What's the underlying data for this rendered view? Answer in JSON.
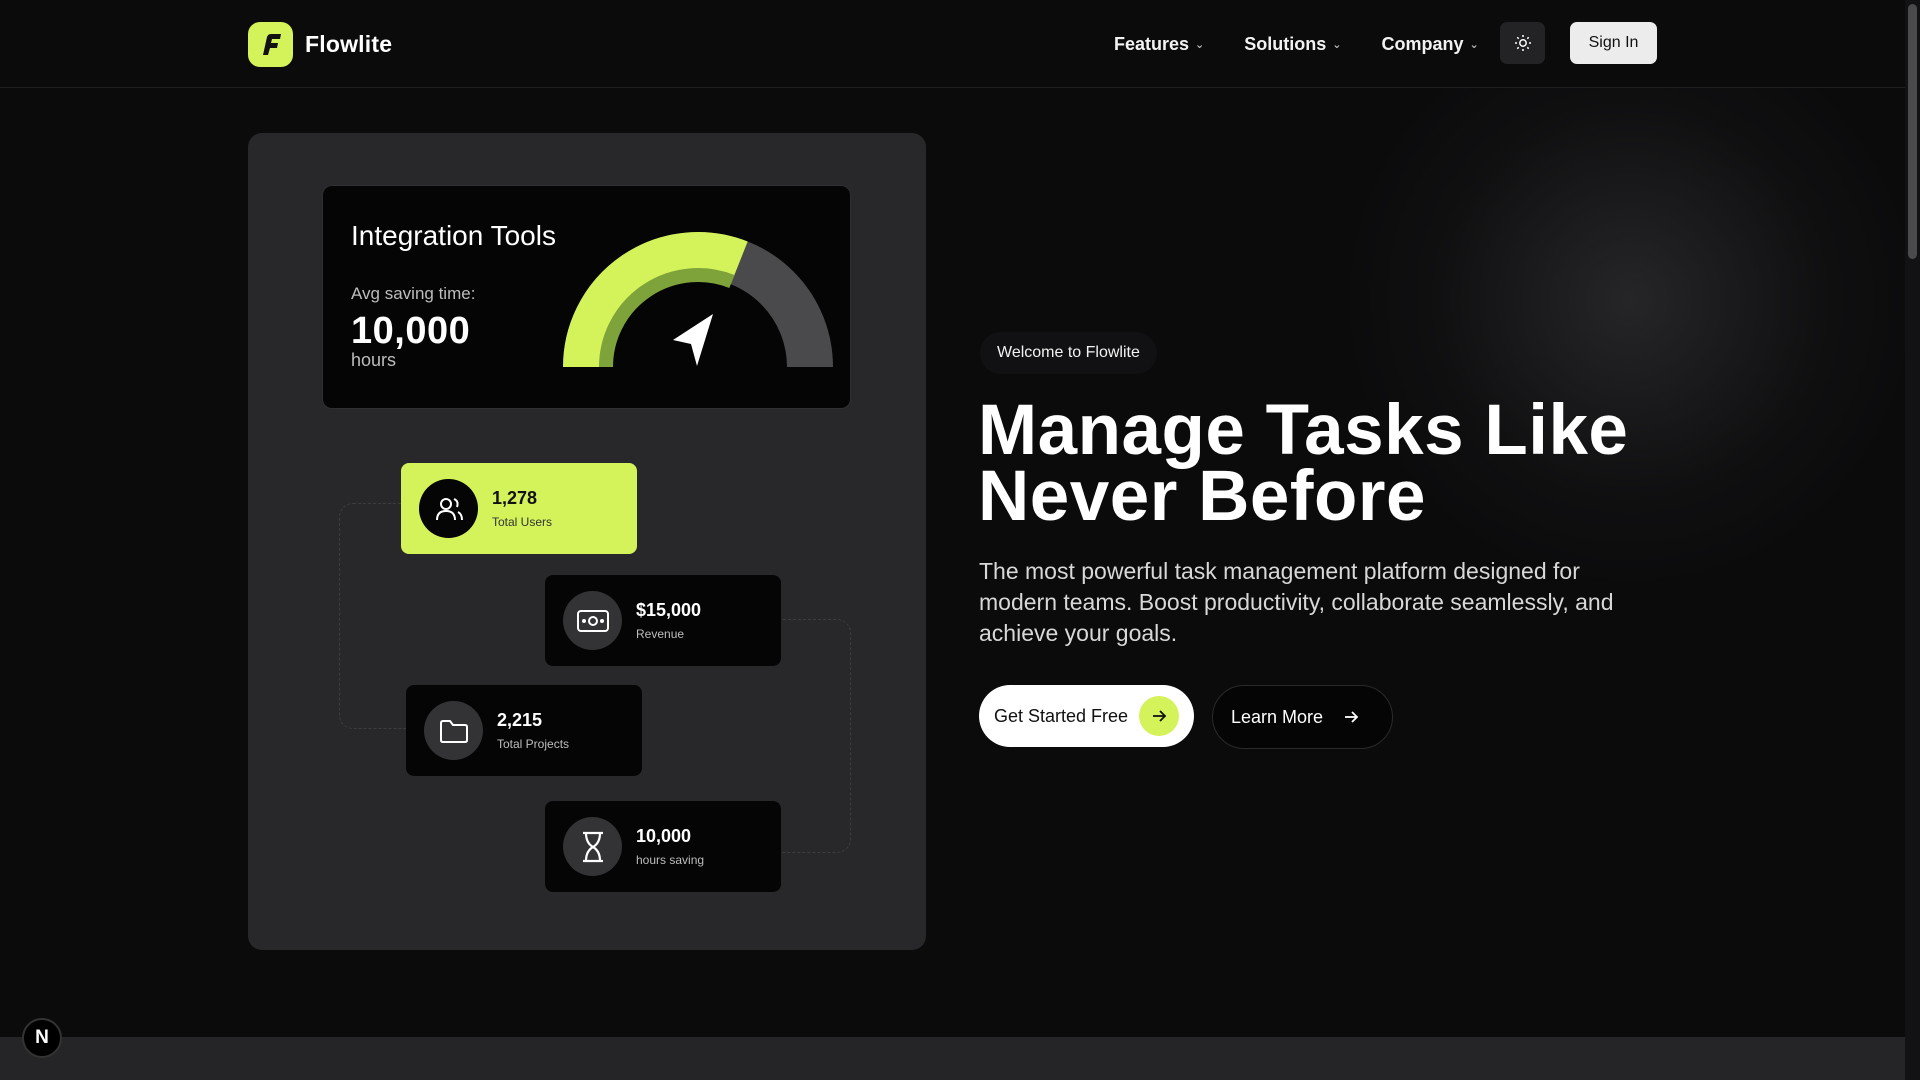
{
  "brand": {
    "name": "Flowlite"
  },
  "nav": {
    "items": [
      {
        "label": "Features"
      },
      {
        "label": "Solutions"
      },
      {
        "label": "Company"
      }
    ],
    "theme_icon": "sun-icon",
    "signin_label": "Sign In"
  },
  "integration_card": {
    "title": "Integration Tools",
    "subtitle": "Avg saving time:",
    "value": "10,000",
    "unit": "hours",
    "gauge_fill": 0.62
  },
  "stats": [
    {
      "value": "1,278",
      "label": "Total Users",
      "icon": "users-icon"
    },
    {
      "value": "$15,000",
      "label": "Revenue",
      "icon": "banknote-icon"
    },
    {
      "value": "2,215",
      "label": "Total Projects",
      "icon": "folder-icon"
    },
    {
      "value": "10,000",
      "label": "hours saving",
      "icon": "hourglass-icon"
    }
  ],
  "hero": {
    "badge": "Welcome to Flowlite",
    "headline": "Manage Tasks Like Never Before",
    "description": "The most powerful task management platform designed for modern teams. Boost productivity, collaborate seamlessly, and achieve your goals.",
    "primary_cta": "Get Started Free",
    "secondary_cta": "Learn More"
  },
  "dev_badge": "N",
  "colors": {
    "accent": "#d4f25a",
    "background": "#0b0b0c",
    "panel": "#28282b"
  }
}
